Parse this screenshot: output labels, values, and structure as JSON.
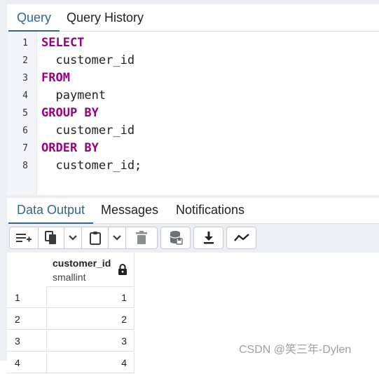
{
  "query_tabs": [
    {
      "label": "Query",
      "active": true
    },
    {
      "label": "Query History",
      "active": false
    }
  ],
  "editor": {
    "lines": [
      {
        "num": "1",
        "text": "SELECT",
        "keyword": true
      },
      {
        "num": "2",
        "text": "  customer_id",
        "keyword": false
      },
      {
        "num": "3",
        "text": "FROM",
        "keyword": true
      },
      {
        "num": "4",
        "text": "  payment",
        "keyword": false
      },
      {
        "num": "5",
        "text": "GROUP BY",
        "keyword": true
      },
      {
        "num": "6",
        "text": "  customer_id",
        "keyword": false
      },
      {
        "num": "7",
        "text": "ORDER BY",
        "keyword": true
      },
      {
        "num": "8",
        "text": "  customer_id;",
        "keyword": false
      }
    ]
  },
  "output_tabs": [
    {
      "label": "Data Output",
      "active": true
    },
    {
      "label": "Messages",
      "active": false
    },
    {
      "label": "Notifications",
      "active": false
    }
  ],
  "toolbar": {
    "icons": [
      "add-row-icon",
      "copy-icon",
      "chevron-down-icon",
      "paste-icon",
      "chevron-down-icon",
      "delete-icon",
      "save-data-icon",
      "download-icon",
      "graph-icon"
    ]
  },
  "grid": {
    "column": {
      "name": "customer_id",
      "type": "smallint"
    },
    "rows": [
      {
        "num": "1",
        "value": "1"
      },
      {
        "num": "2",
        "value": "2"
      },
      {
        "num": "3",
        "value": "3"
      },
      {
        "num": "4",
        "value": "4"
      }
    ]
  },
  "watermark": "CSDN @笑三年-Dylen",
  "colors": {
    "accent": "#326690",
    "keyword": "#990080",
    "panel_bg": "#ebeef3",
    "border": "#dde0e6"
  }
}
